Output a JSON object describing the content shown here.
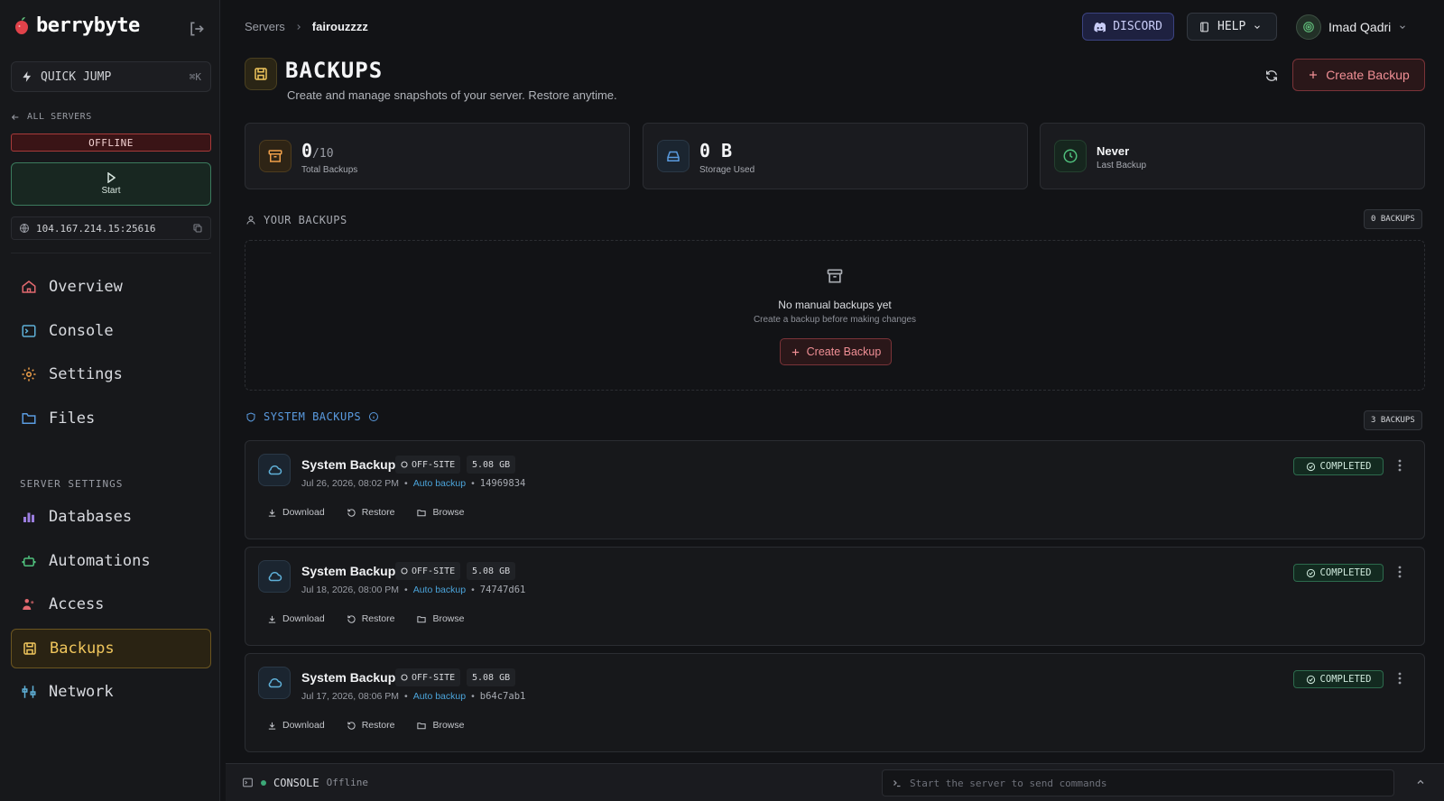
{
  "brand": {
    "name": "berrybyte"
  },
  "sidebar": {
    "quick_jump": {
      "label": "QUICK JUMP",
      "shortcut": "⌘K"
    },
    "all_servers": "ALL SERVERS",
    "status": "OFFLINE",
    "start_label": "Start",
    "ip": "104.167.214.15:25616",
    "nav": [
      {
        "label": "Overview",
        "icon": "home-icon"
      },
      {
        "label": "Console",
        "icon": "terminal-icon"
      },
      {
        "label": "Settings",
        "icon": "gear-icon"
      },
      {
        "label": "Files",
        "icon": "folder-icon"
      }
    ],
    "section_label": "SERVER SETTINGS",
    "settings_nav": [
      {
        "label": "Databases",
        "icon": "chart-icon"
      },
      {
        "label": "Automations",
        "icon": "robot-icon"
      },
      {
        "label": "Access",
        "icon": "users-icon"
      },
      {
        "label": "Backups",
        "icon": "backup-icon",
        "active": true
      },
      {
        "label": "Network",
        "icon": "network-icon"
      }
    ]
  },
  "header": {
    "breadcrumb": [
      "Servers",
      "fairouzzzz"
    ],
    "discord": "DISCORD",
    "help": "HELP",
    "user_name": "Imad Qadri"
  },
  "page": {
    "title": "BACKUPS",
    "subtitle": "Create and manage snapshots of your server. Restore anytime.",
    "create_label": "Create Backup"
  },
  "stats": {
    "total": {
      "value": "0",
      "max": "/10",
      "label": "Total Backups"
    },
    "storage": {
      "value": "0 B",
      "label": "Storage Used"
    },
    "last": {
      "value": "Never",
      "label": "Last Backup"
    }
  },
  "your_backups": {
    "heading": "YOUR BACKUPS",
    "count_badge": "0 BACKUPS",
    "empty_title": "No manual backups yet",
    "empty_sub": "Create a backup before making changes",
    "create_label": "Create Backup"
  },
  "system_backups": {
    "heading": "SYSTEM BACKUPS",
    "count_badge": "3 BACKUPS",
    "items": [
      {
        "title": "System Backup",
        "location": "OFF-SITE",
        "size": "5.08 GB",
        "date": "Jul 26, 2026, 08:02 PM",
        "type": "Auto backup",
        "hash": "14969834",
        "status": "COMPLETED"
      },
      {
        "title": "System Backup",
        "location": "OFF-SITE",
        "size": "5.08 GB",
        "date": "Jul 18, 2026, 08:00 PM",
        "type": "Auto backup",
        "hash": "74747d61",
        "status": "COMPLETED"
      },
      {
        "title": "System Backup",
        "location": "OFF-SITE",
        "size": "5.08 GB",
        "date": "Jul 17, 2026, 08:06 PM",
        "type": "Auto backup",
        "hash": "b64c7ab1",
        "status": "COMPLETED"
      }
    ],
    "actions": {
      "download": "Download",
      "restore": "Restore",
      "browse": "Browse"
    }
  },
  "console_bar": {
    "label": "CONSOLE",
    "state": "Offline",
    "input_placeholder": "Start the server to send commands"
  },
  "colors": {
    "accent_red": "#f08f95",
    "active_yellow": "#f0c65c",
    "success_green": "#3ca877",
    "link_blue": "#4ba3d9"
  }
}
